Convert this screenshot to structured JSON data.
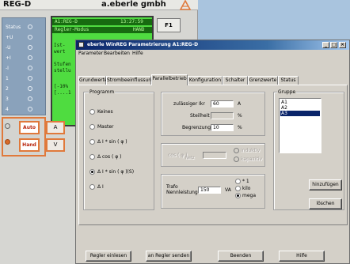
{
  "device": {
    "model": "REG-D",
    "brand": "a.eberle gmbh",
    "status": [
      {
        "label": "Status"
      },
      {
        "label": "+U"
      },
      {
        "label": "-U"
      },
      {
        "label": "+I"
      },
      {
        "label": "-I"
      },
      {
        "label": "1"
      },
      {
        "label": "2"
      },
      {
        "label": "3"
      },
      {
        "label": "4"
      }
    ],
    "lcd": {
      "row1_left": "A1:REG-D",
      "row1_right": "13:27:59",
      "row2_left": "Regler-Modus",
      "row2_right": "HAND",
      "line3": "Ist-",
      "line4": "wert",
      "line5": "Stufen",
      "line6": "stellu",
      "line7": "[-10%",
      "line8": "[....1"
    },
    "f1_label": "F1",
    "auto_label": "Auto",
    "hand_label": "Hand",
    "a_label": "A",
    "v_label": "V"
  },
  "window": {
    "title": "eberle WinREG Parametrierung A1:REG-D",
    "menu": [
      "Parameter",
      "Bearbeiten",
      "Hilfe"
    ],
    "tabs": [
      "Grundwerte",
      "Strombeeinflussung",
      "Parallelbetrieb",
      "Konfiguration",
      "Schalter",
      "Grenzwerte",
      "Status"
    ],
    "active_tab": "Parallelbetrieb",
    "programm": {
      "title": "Programm",
      "options": [
        "Keines",
        "Master",
        "Δ I * sin ( φ )",
        "Δ cos ( φ )",
        "Δ I * sin ( φ )(S)",
        "Δ I"
      ],
      "selected_index": 4
    },
    "params": {
      "zul_label": "zulässiger Ikr",
      "zul_value": "60",
      "zul_unit": "A",
      "steil_label": "Steilheit",
      "steil_value": "",
      "steil_unit": "%",
      "begr_label": "Begrenzung",
      "begr_value": "10",
      "begr_unit": "%"
    },
    "cos": {
      "label": "cos ( φ )",
      "sub": "Netz",
      "value": "",
      "opt1": "induktiv",
      "opt2": "kapazitiv"
    },
    "trafo": {
      "label1": "Trafo",
      "label2": "Nennleistung",
      "value": "150",
      "unit": "VA",
      "opt1": "* 1",
      "opt2": "kilo",
      "opt3": "mega",
      "selected": "mega"
    },
    "gruppe": {
      "title": "Gruppe",
      "items": [
        "A1",
        "A2",
        "A3"
      ],
      "selected": "A3"
    },
    "side_buttons": [
      "hinzufügen",
      "löschen"
    ],
    "bottom_buttons": [
      "Regler einlesen",
      "an Regler senden",
      "Beenden",
      "Hilfe"
    ]
  }
}
